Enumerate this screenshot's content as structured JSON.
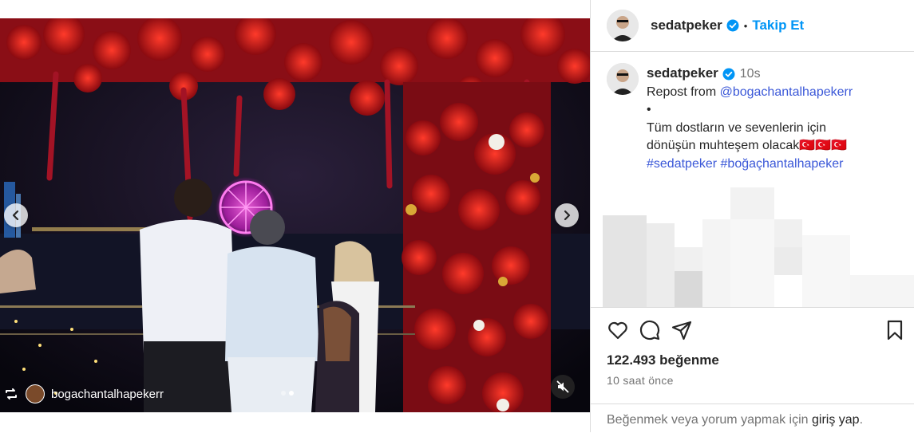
{
  "post": {
    "repost_tag_user": "bogachantalhapekerr",
    "carousel_count": 2,
    "carousel_active_index": 1
  },
  "header": {
    "username": "sedatpeker",
    "separator": "•",
    "follow_label": "Takip Et"
  },
  "caption": {
    "username": "sedatpeker",
    "time": "10s",
    "line1_prefix": "Repost from ",
    "line1_mention": "@bogachantalhapekerr",
    "line2": "•",
    "line3": "Tüm dostların ve sevenlerin için",
    "line4": "dönüşün muhteşem olacak🇹🇷🇹🇷🇹🇷",
    "hashtag1": "#sedatpeker",
    "hashtag2": "#boğaçhantalhapeker"
  },
  "actions": {
    "likes": "122.493 beğenme",
    "time_ago": "10 saat önce"
  },
  "login": {
    "prefix": "Beğenmek veya yorum yapmak için ",
    "link": "giriş yap",
    "suffix": "."
  },
  "colors": {
    "accent": "#0095f6",
    "verified": "#0095f6",
    "text": "#262626",
    "muted": "#737373"
  }
}
